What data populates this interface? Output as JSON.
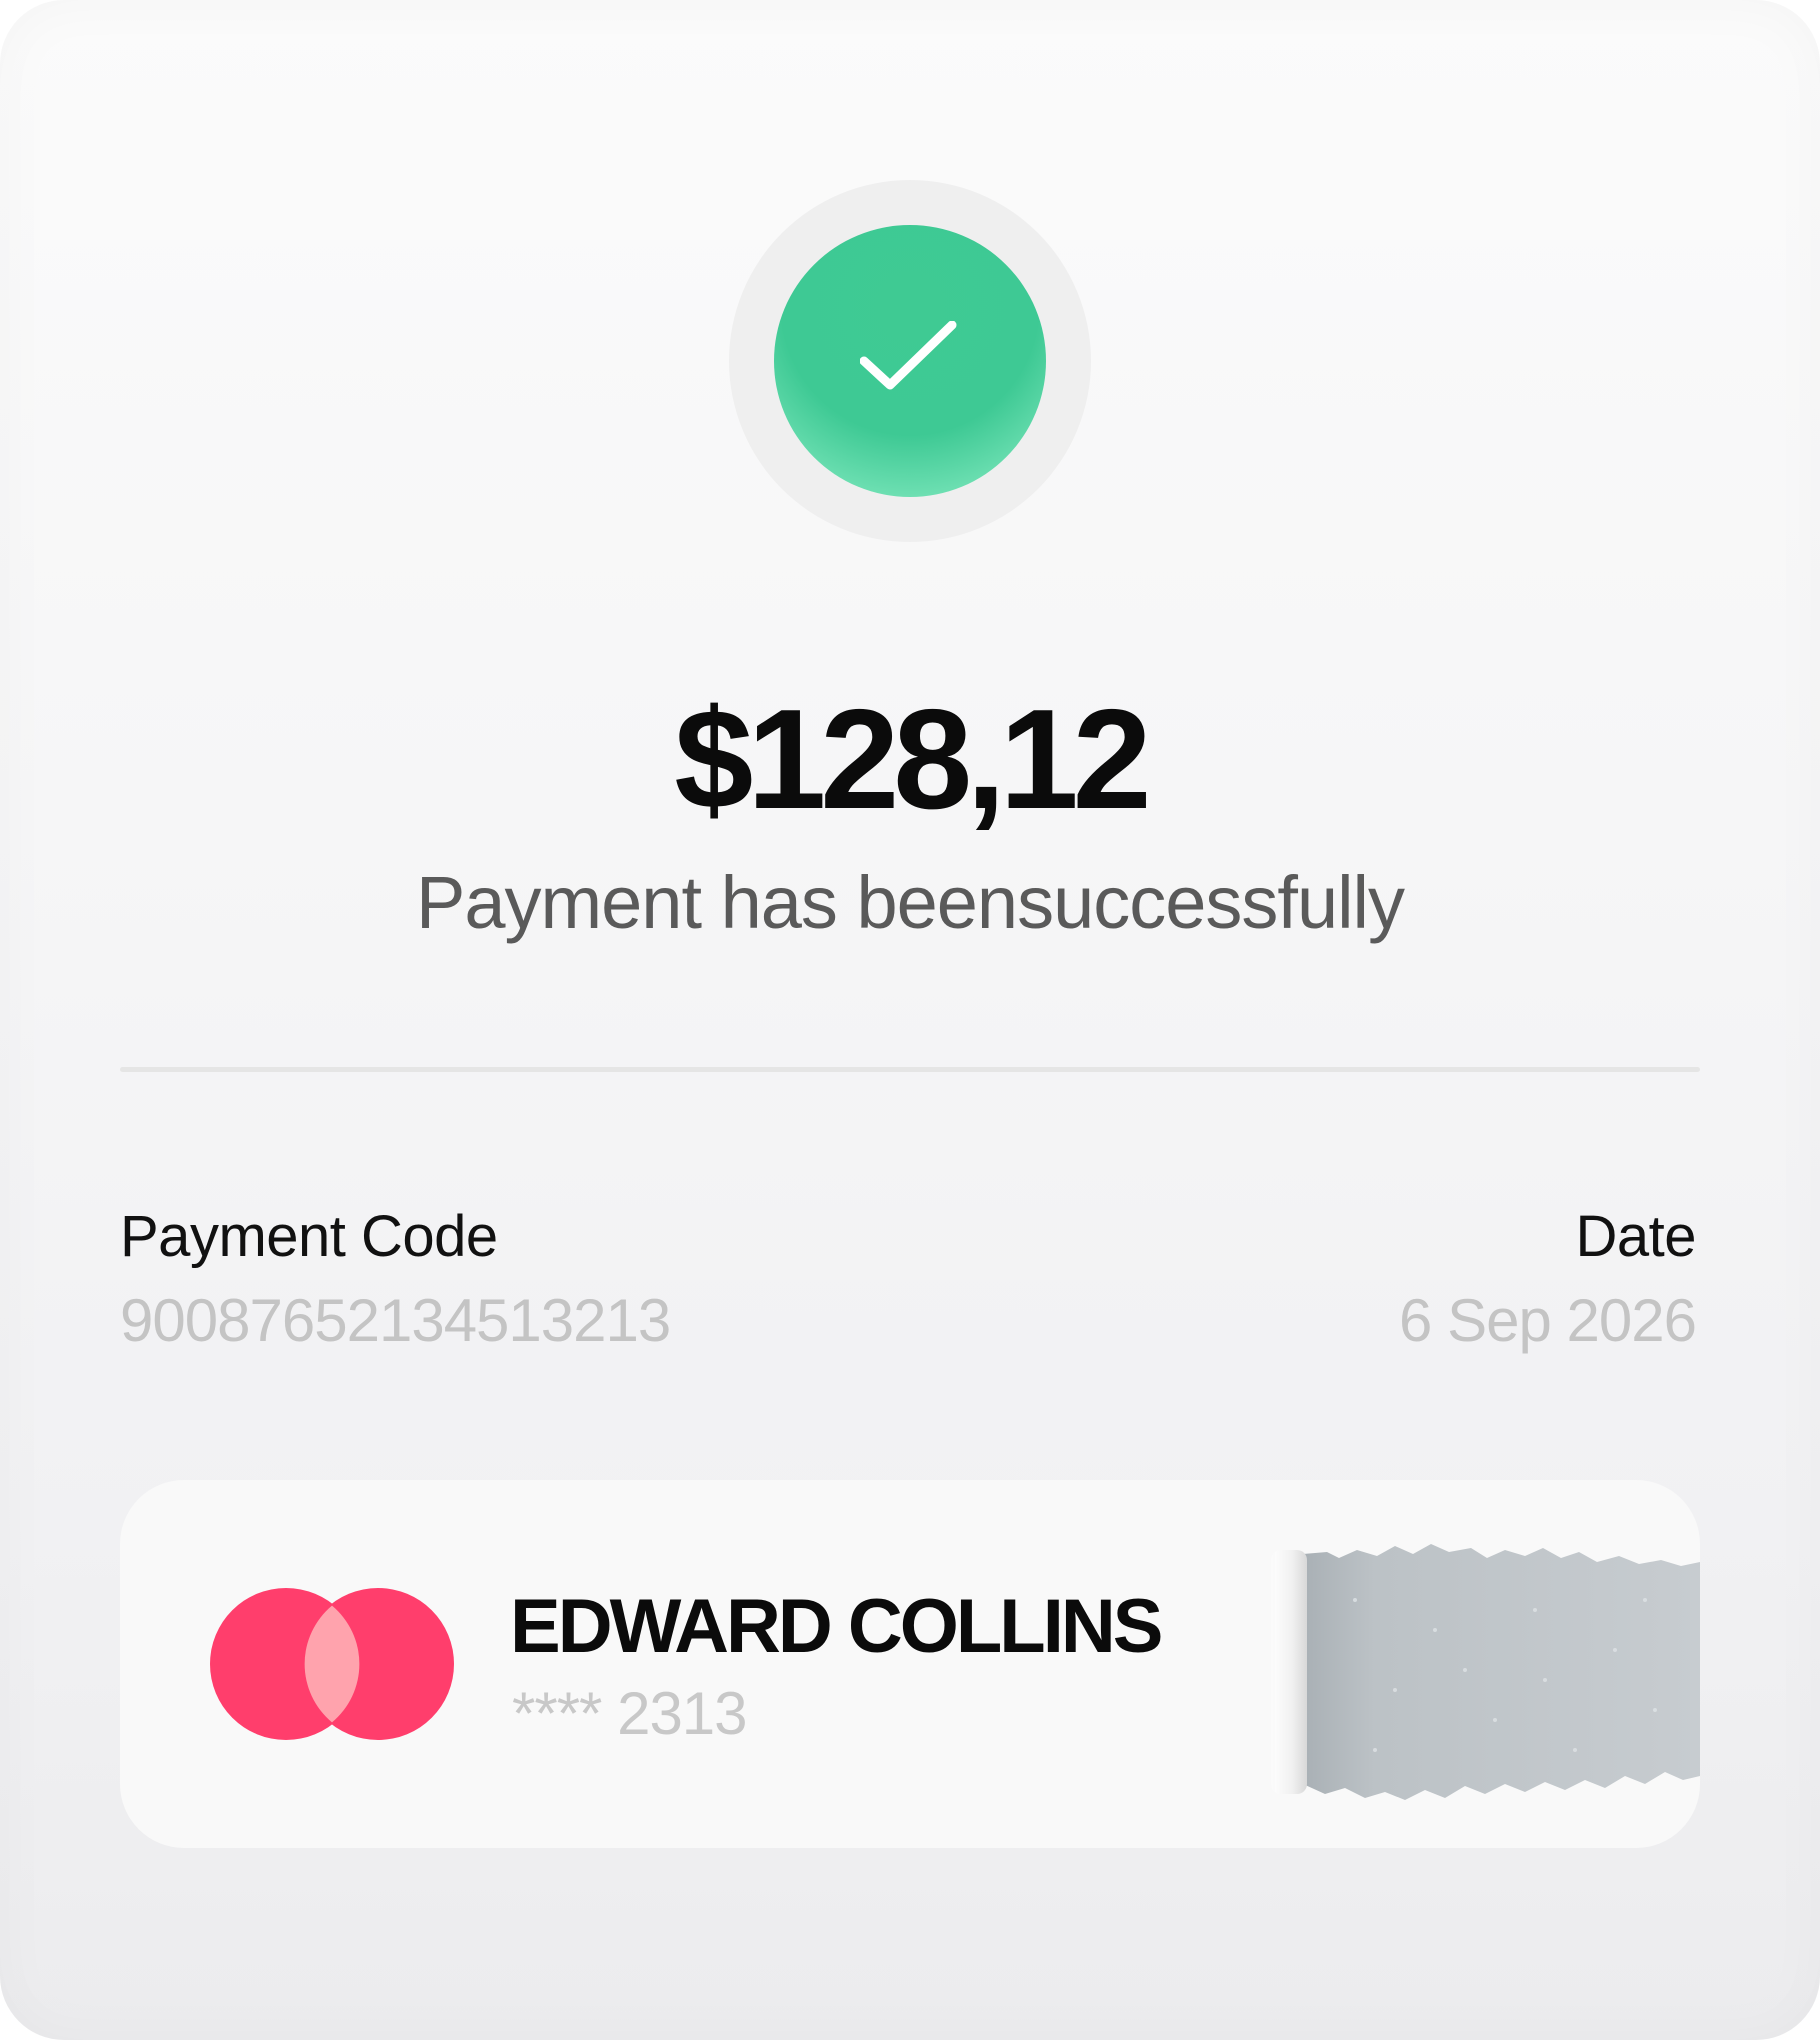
{
  "amount": "$128,12",
  "status_message": "Payment has beensuccessfully",
  "details": {
    "payment_code_label": "Payment Code",
    "payment_code_value": "90087652134513213",
    "date_label": "Date",
    "date_value": "6 Sep 2026"
  },
  "card": {
    "holder_name": "EDWARD COLLINS",
    "number_mask": "**** 2313",
    "logo_color": "#ff3e6c",
    "logo_overlap_color": "#ffa3ad"
  },
  "colors": {
    "success": "#3ec994",
    "text_primary": "#0b0b0b",
    "text_secondary": "#5a5a5a",
    "text_muted": "#c4c4c4"
  },
  "icons": {
    "status": "check-icon",
    "card_brand": "card-brand-logo-icon"
  }
}
